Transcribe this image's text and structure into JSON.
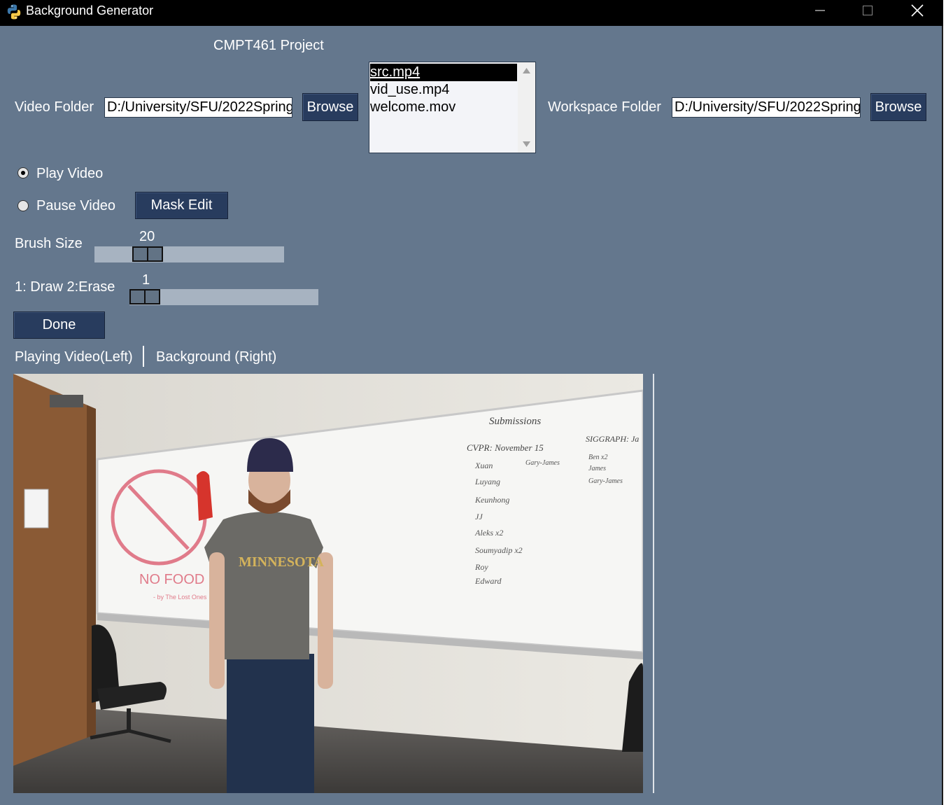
{
  "window": {
    "title": "Background Generator"
  },
  "header": {
    "project_title": "CMPT461 Project"
  },
  "video_folder": {
    "label": "Video Folder",
    "value": "D:/University/SFU/2022Spring/",
    "browse_label": "Browse"
  },
  "file_list": {
    "items": [
      "src.mp4",
      "vid_use.mp4",
      "welcome.mov"
    ],
    "selected": "src.mp4"
  },
  "workspace_folder": {
    "label": "Workspace Folder",
    "value": "D:/University/SFU/2022Spring/",
    "browse_label": "Browse"
  },
  "playback": {
    "play_label": "Play Video",
    "pause_label": "Pause Video",
    "selected": "Play Video",
    "mask_edit_label": "Mask Edit"
  },
  "brush_size": {
    "label": "Brush Size",
    "value": "20"
  },
  "draw_mode": {
    "label": "1: Draw  2:Erase",
    "value": "1"
  },
  "done_label": "Done",
  "panels": {
    "left_label": "Playing Video(Left)",
    "right_label": "Background (Right)"
  },
  "video_frame": {
    "board_heading": "Submissions",
    "cvpr_heading": "CVPR: November 15",
    "siggraph_heading": "SIGGRAPH: Ja",
    "cvpr_names": [
      "Xuan",
      "Luyang",
      "Keunhong",
      "JJ",
      "Aleks x2",
      "Soumyadip x2",
      "Roy",
      "Edward"
    ],
    "cvpr_side": "Gary-James",
    "siggraph_names": [
      "Ben x2",
      "James",
      "Gary-James"
    ],
    "sign_text": "NO FOOD",
    "sign_sub": "- by The Lost Ones",
    "shirt_text": "MINNESOTA"
  },
  "colors": {
    "background": "#64778d",
    "button": "#283c5e",
    "titlebar": "#000000"
  }
}
